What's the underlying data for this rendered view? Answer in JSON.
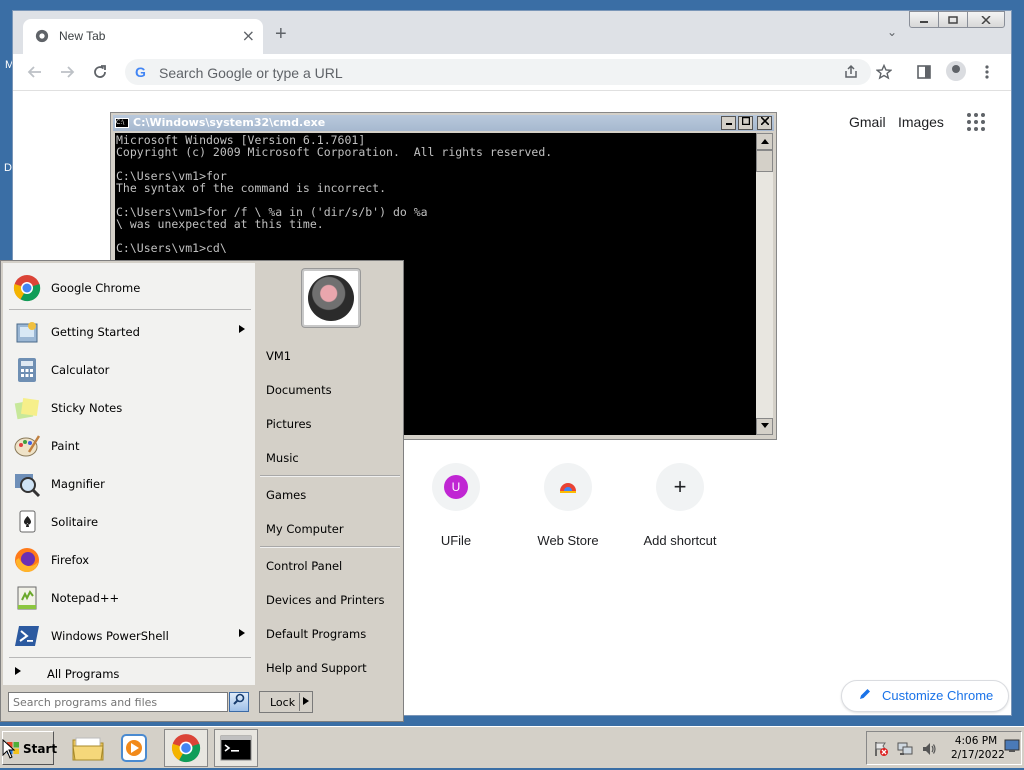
{
  "desktop": {
    "edge_char_1": "M",
    "edge_char_2": "D"
  },
  "chrome": {
    "tab_title": "New Tab",
    "tab_close": "×",
    "new_tab": "+",
    "search_tabs": "⌄",
    "omnibox_placeholder": "Search Google or type a URL",
    "google_g": "G",
    "ntp": {
      "gmail": "Gmail",
      "images": "Images",
      "shortcuts": [
        {
          "label": "UFile",
          "letter": "U"
        },
        {
          "label": "Web Store"
        },
        {
          "label": "Add shortcut",
          "glyph": "+"
        }
      ],
      "customize": "Customize Chrome"
    }
  },
  "cmd": {
    "title": "C:\\Windows\\system32\\cmd.exe",
    "lines": [
      "Microsoft Windows [Version 6.1.7601]",
      "Copyright (c) 2009 Microsoft Corporation.  All rights reserved.",
      "",
      "C:\\Users\\vm1>for",
      "The syntax of the command is incorrect.",
      "",
      "C:\\Users\\vm1>for /f \\ %a in ('dir/s/b') do %a",
      "\\ was unexpected at this time.",
      "",
      "C:\\Users\\vm1>cd\\"
    ]
  },
  "start_menu": {
    "pinned": [
      {
        "label": "Google Chrome",
        "icon": "chrome-icon"
      }
    ],
    "programs": [
      {
        "label": "Getting Started",
        "submenu": true
      },
      {
        "label": "Calculator"
      },
      {
        "label": "Sticky Notes"
      },
      {
        "label": "Paint"
      },
      {
        "label": "Magnifier"
      },
      {
        "label": "Solitaire"
      },
      {
        "label": "Firefox"
      },
      {
        "label": "Notepad++"
      },
      {
        "label": "Windows PowerShell",
        "submenu": true
      }
    ],
    "all_programs": "All Programs",
    "search_placeholder": "Search programs and files",
    "right": {
      "group1": [
        "VM1",
        "Documents",
        "Pictures",
        "Music"
      ],
      "group2": [
        "Games",
        "My Computer"
      ],
      "group3": [
        "Control Panel",
        "Devices and Printers",
        "Default Programs",
        "Help and Support"
      ]
    },
    "lock": "Lock"
  },
  "taskbar": {
    "start": "Start",
    "time": "4:06 PM",
    "date": "2/17/2022"
  }
}
